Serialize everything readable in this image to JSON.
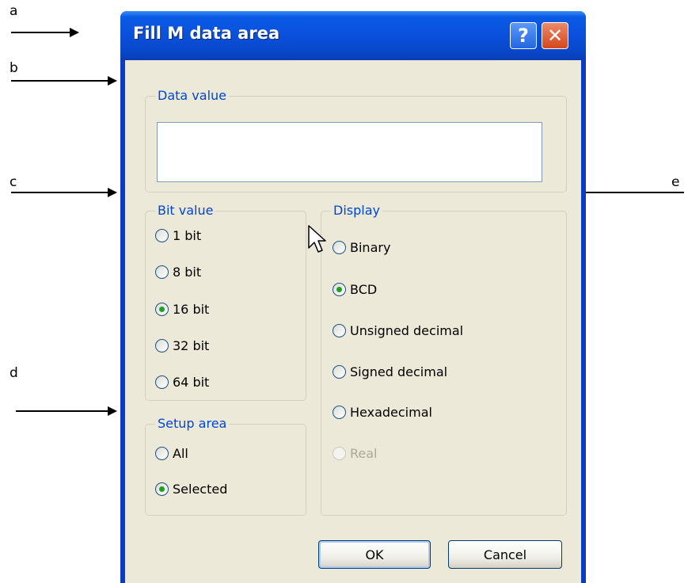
{
  "callouts": {
    "a": "a",
    "b": "b",
    "c": "c",
    "d": "d",
    "e": "e"
  },
  "dialog": {
    "title": "Fill M data area",
    "help_glyph": "?",
    "close_glyph": "✕"
  },
  "data_value": {
    "label": "Data value",
    "value": ""
  },
  "bit_value": {
    "label": "Bit value",
    "options": [
      "1 bit",
      "8 bit",
      "16 bit",
      "32 bit",
      "64 bit"
    ],
    "selected": "16 bit"
  },
  "setup_area": {
    "label": "Setup area",
    "options": [
      "All",
      "Selected"
    ],
    "selected": "Selected"
  },
  "display": {
    "label": "Display",
    "options": [
      "Binary",
      "BCD",
      "Unsigned decimal",
      "Signed decimal",
      "Hexadecimal",
      "Real"
    ],
    "selected": "BCD",
    "disabled": [
      "Real"
    ]
  },
  "buttons": {
    "ok": "OK",
    "cancel": "Cancel"
  },
  "icons": {
    "help": "help-icon",
    "close": "close-icon",
    "cursor": "mouse-pointer-icon"
  },
  "colors": {
    "titlebar": "#0a50dc",
    "group_label": "#0046d5",
    "radio_dot": "#21a121",
    "dialog_bg": "#ece9d8"
  }
}
